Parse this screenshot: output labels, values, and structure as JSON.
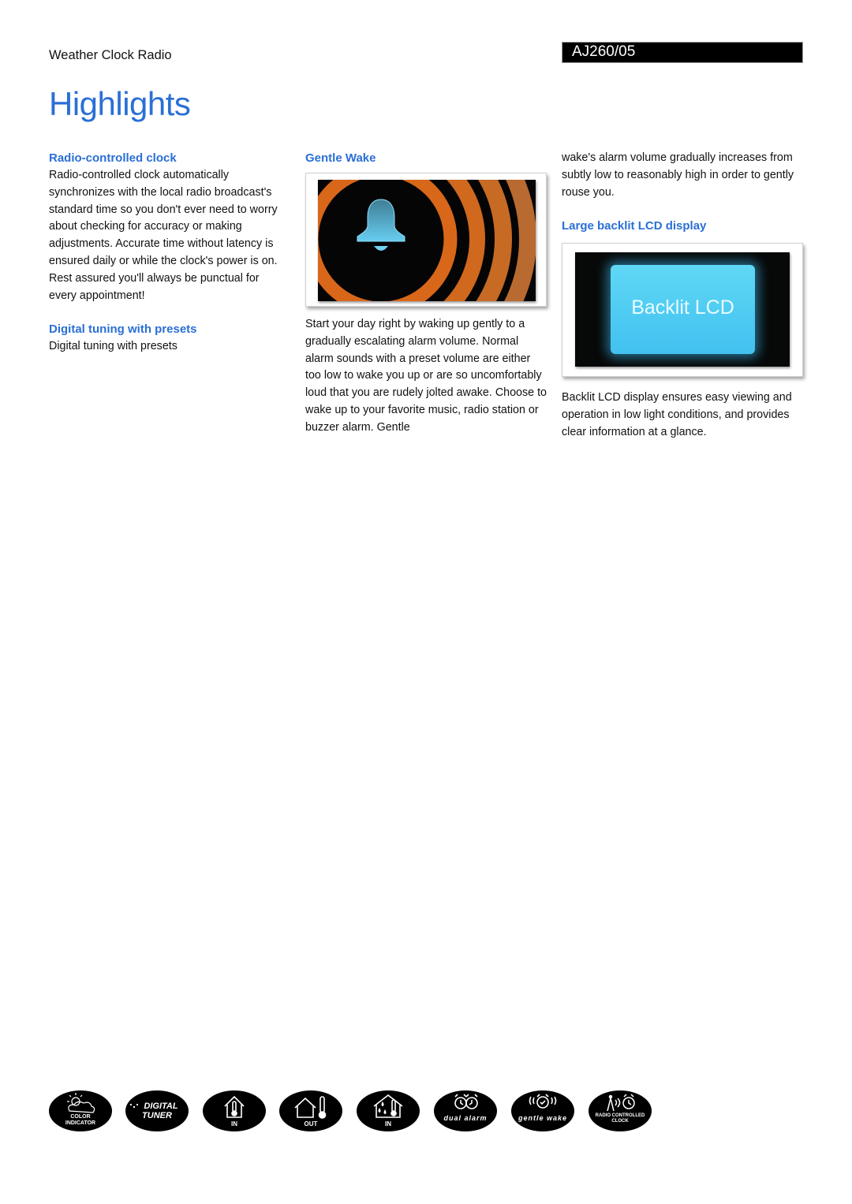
{
  "header": {
    "subtitle": "Weather Clock Radio",
    "model": "AJ260/05",
    "title": "Highlights"
  },
  "features": {
    "radio_clock": {
      "title": "Radio-controlled clock",
      "text": "Radio-controlled clock automatically synchronizes with the local radio broadcast's standard time so you don't ever need to worry about checking for accuracy or making adjustments. Accurate time without latency is ensured daily or while the clock's power is on. Rest assured you'll always be punctual for every appointment!"
    },
    "digital_tuning": {
      "title": "Digital tuning with presets",
      "text": "Digital tuning with presets"
    },
    "gentle_wake": {
      "title": "Gentle Wake",
      "text": "Start your day right by waking up gently to a gradually escalating alarm volume. Normal alarm sounds with a preset volume are either too low to wake you up or are so uncomfortably loud that you are rudely jolted awake. Choose to wake up to your favorite music, radio station or buzzer alarm. Gentle",
      "text_continued": "wake's alarm volume gradually increases from subtly low to reasonably high in order to gently rouse you."
    },
    "lcd": {
      "title": "Large backlit LCD display",
      "image_label": "Backlit LCD",
      "text": "Backlit LCD display ensures easy viewing and operation in low light conditions, and provides clear information at a glance."
    }
  },
  "colors": {
    "accent": "#2a6fd6",
    "wake_ring": "#d2691e",
    "bell": "#5ec4ea",
    "lcd": "#4cc8f2"
  },
  "badges": [
    {
      "icon": "weather-cloud-sun-icon",
      "label1": "COLOR",
      "label2": "INDICATOR"
    },
    {
      "icon": "digital-tuner-icon",
      "label1": "DIGITAL",
      "label2": "TUNER"
    },
    {
      "icon": "indoor-temperature-icon",
      "label1": "IN"
    },
    {
      "icon": "outdoor-temperature-icon",
      "label1": "OUT"
    },
    {
      "icon": "indoor-humidity-icon",
      "label1": "IN"
    },
    {
      "icon": "dual-alarm-icon",
      "label1": "dual alarm"
    },
    {
      "icon": "gentle-wake-icon",
      "label1": "gentle wake"
    },
    {
      "icon": "radio-controlled-clock-icon",
      "label1": "RADIO CONTROLLED",
      "label2": "CLOCK"
    }
  ]
}
